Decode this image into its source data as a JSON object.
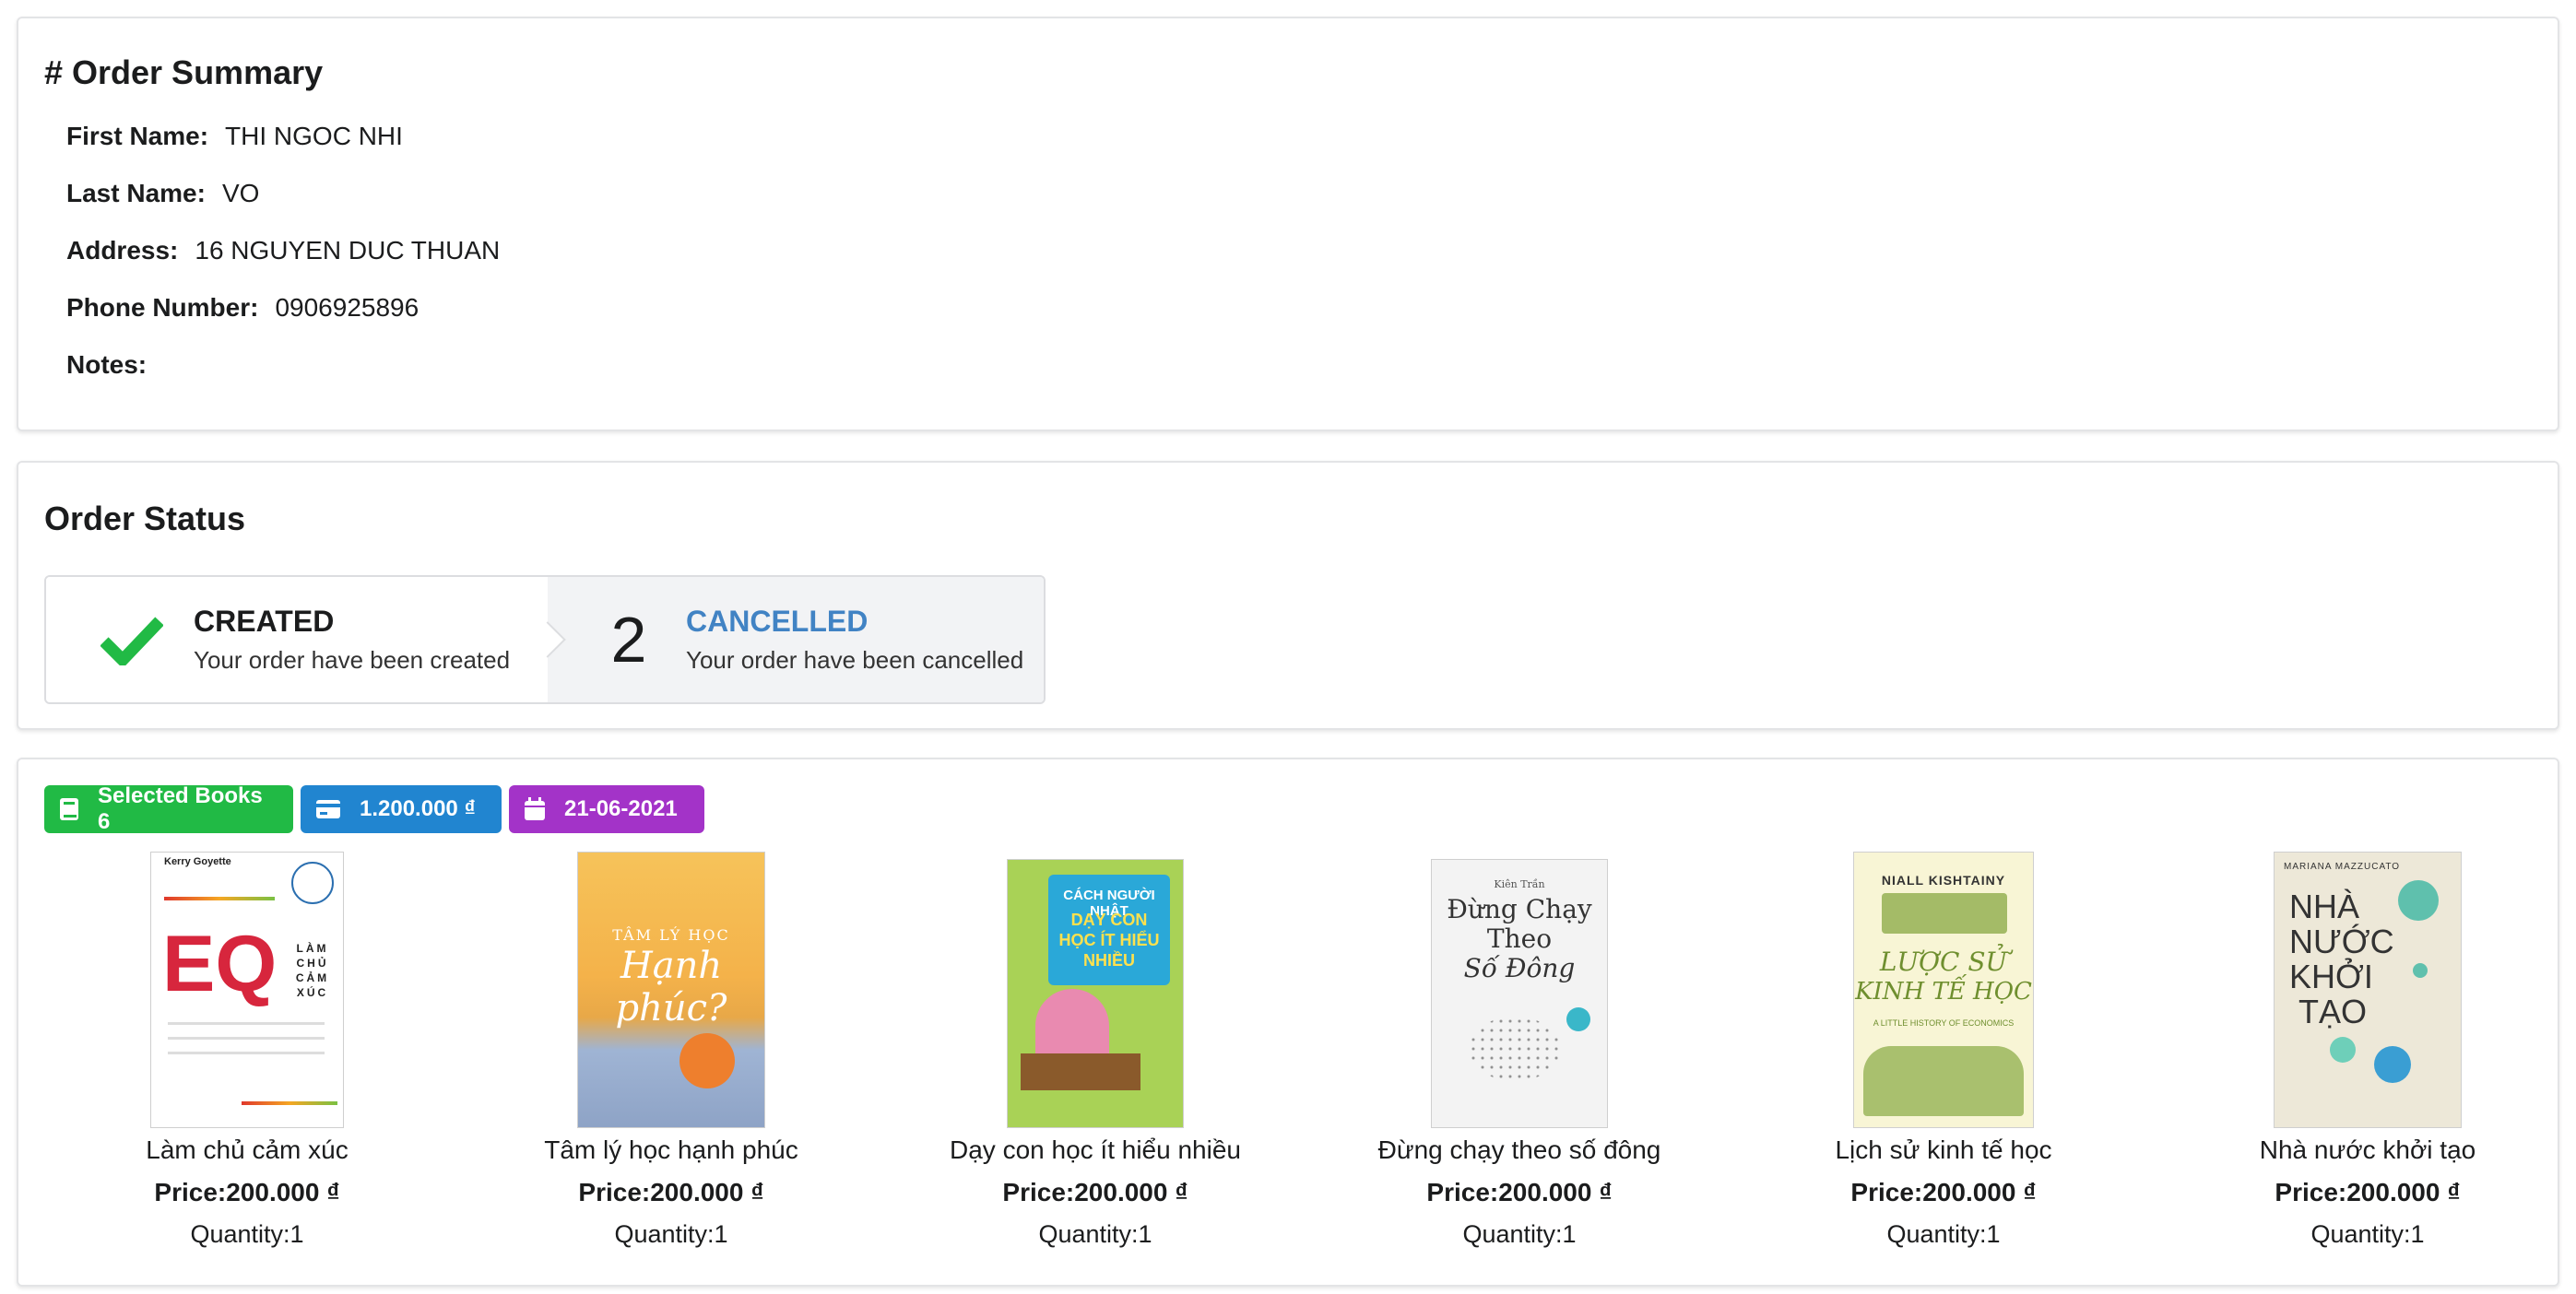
{
  "summary": {
    "title": "# Order Summary",
    "first_name_label": "First Name:",
    "first_name": "THI NGOC NHI",
    "last_name_label": "Last Name:",
    "last_name": "VO",
    "address_label": "Address:",
    "address": "16 NGUYEN DUC THUAN",
    "phone_label": "Phone Number:",
    "phone": "0906925896",
    "notes_label": "Notes:",
    "notes": ""
  },
  "status": {
    "title": "Order Status",
    "steps": [
      {
        "title": "CREATED",
        "description": "Your order have been created",
        "icon": "check-icon",
        "color": "#21ba45"
      },
      {
        "number": "2",
        "title": "CANCELLED",
        "description": "Your order have been cancelled",
        "color": "#4183c4"
      }
    ]
  },
  "labels": {
    "selected_books": "Selected Books 6",
    "total": "1.200.000 ₫",
    "date": "21-06-2021",
    "icons": [
      "book-icon",
      "credit-card-icon",
      "calendar-icon"
    ],
    "colors": [
      "#21ba45",
      "#2185d0",
      "#a333c8"
    ]
  },
  "books": [
    {
      "title": "Làm chủ cảm xúc",
      "price": "Price:200.000 ₫",
      "quantity": "Quantity:1",
      "cover": {
        "author": "Kerry Goyette",
        "big": "EQ",
        "sub": "LÀM CHỦ CẢM XÚC"
      }
    },
    {
      "title": "Tâm lý học hạnh phúc",
      "price": "Price:200.000 ₫",
      "quantity": "Quantity:1",
      "cover": {
        "line1": "TÂM LÝ HỌC",
        "line2": "Hạnh phúc?"
      }
    },
    {
      "title": "Dạy con học ít hiểu nhiều",
      "price": "Price:200.000 ₫",
      "quantity": "Quantity:1",
      "cover": {
        "line1": "CÁCH NGƯỜI NHẬT",
        "line2": "DẠY CON HỌC ÍT HIỂU NHIỀU"
      }
    },
    {
      "title": "Đừng chạy theo số đông",
      "price": "Price:200.000 ₫",
      "quantity": "Quantity:1",
      "cover": {
        "author": "Kiên Trần",
        "line1": "Đừng Chạy",
        "line2": "Theo",
        "line3": "Số Đông"
      }
    },
    {
      "title": "Lịch sử kinh tế học",
      "price": "Price:200.000 ₫",
      "quantity": "Quantity:1",
      "cover": {
        "author": "NIALL KISHTAINY",
        "line1": "LƯỢC SỬ",
        "line2": "KINH TẾ HỌC",
        "line3": "A LITTLE HISTORY OF ECONOMICS"
      }
    },
    {
      "title": "Nhà nước khởi tạo",
      "price": "Price:200.000 ₫",
      "quantity": "Quantity:1",
      "cover": {
        "author": "MARIANA MAZZUCATO",
        "line1": "NHÀ",
        "line2": "NƯỚC",
        "line3": "KHỞI",
        "line4": "TẠO"
      }
    }
  ]
}
